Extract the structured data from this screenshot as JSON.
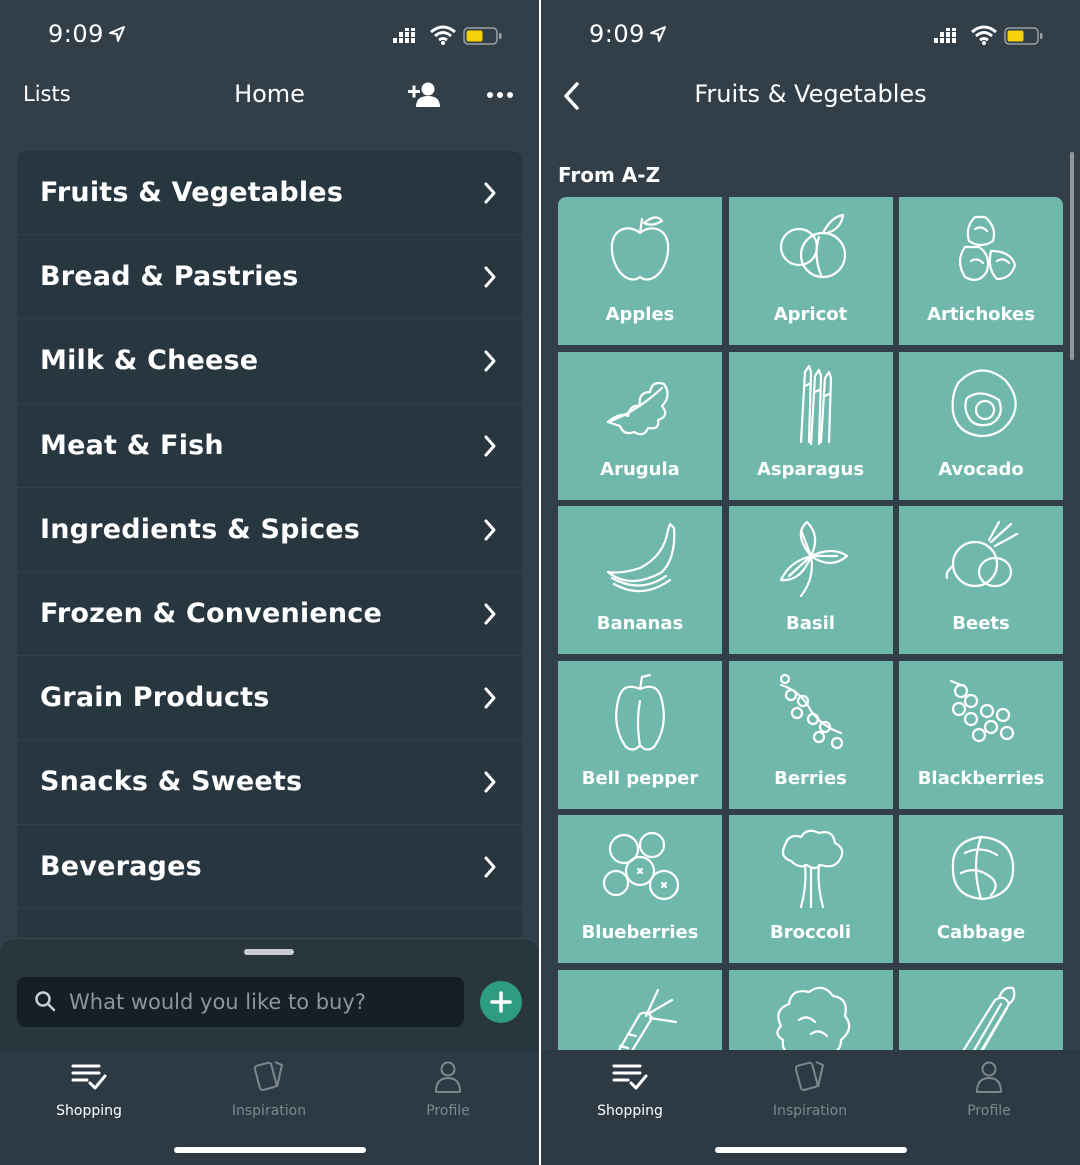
{
  "status_bar": {
    "time": "9:09"
  },
  "left": {
    "nav": {
      "lists_label": "Lists",
      "title": "Home",
      "add_user_icon": "person-add-icon",
      "more_icon": "more-horizontal-icon"
    },
    "categories": [
      {
        "label": "Fruits & Vegetables"
      },
      {
        "label": "Bread & Pastries"
      },
      {
        "label": "Milk & Cheese"
      },
      {
        "label": "Meat & Fish"
      },
      {
        "label": "Ingredients & Spices"
      },
      {
        "label": "Frozen & Convenience"
      },
      {
        "label": "Grain Products"
      },
      {
        "label": "Snacks & Sweets"
      },
      {
        "label": "Beverages"
      }
    ],
    "search": {
      "placeholder": "What would you like to buy?"
    }
  },
  "right": {
    "nav": {
      "title": "Fruits & Vegetables",
      "back_icon": "chevron-left-icon"
    },
    "section_label": "From A-Z",
    "items": [
      {
        "label": "Apples",
        "icon": "apple-icon"
      },
      {
        "label": "Apricot",
        "icon": "apricot-icon"
      },
      {
        "label": "Artichokes",
        "icon": "artichoke-icon"
      },
      {
        "label": "Arugula",
        "icon": "arugula-icon"
      },
      {
        "label": "Asparagus",
        "icon": "asparagus-icon"
      },
      {
        "label": "Avocado",
        "icon": "avocado-icon"
      },
      {
        "label": "Bananas",
        "icon": "banana-icon"
      },
      {
        "label": "Basil",
        "icon": "basil-icon"
      },
      {
        "label": "Beets",
        "icon": "beet-icon"
      },
      {
        "label": "Bell pepper",
        "icon": "bell-pepper-icon"
      },
      {
        "label": "Berries",
        "icon": "berries-icon"
      },
      {
        "label": "Blackberries",
        "icon": "blackberry-icon"
      },
      {
        "label": "Blueberries",
        "icon": "blueberry-icon"
      },
      {
        "label": "Broccoli",
        "icon": "broccoli-icon"
      },
      {
        "label": "Cabbage",
        "icon": "cabbage-icon"
      },
      {
        "label": "",
        "icon": "carrot-icon"
      },
      {
        "label": "",
        "icon": "cauliflower-icon"
      },
      {
        "label": "",
        "icon": "celery-icon"
      }
    ]
  },
  "tabs": [
    {
      "label": "Shopping",
      "icon": "shopping-list-icon",
      "active": true
    },
    {
      "label": "Inspiration",
      "icon": "cards-icon",
      "active": false
    },
    {
      "label": "Profile",
      "icon": "person-icon",
      "active": false
    }
  ],
  "colors": {
    "background": "#323f48",
    "list_bg": "#283640",
    "tile": "#6fb8ab",
    "accent": "#2e9c82",
    "battery": "#f5d20d"
  }
}
